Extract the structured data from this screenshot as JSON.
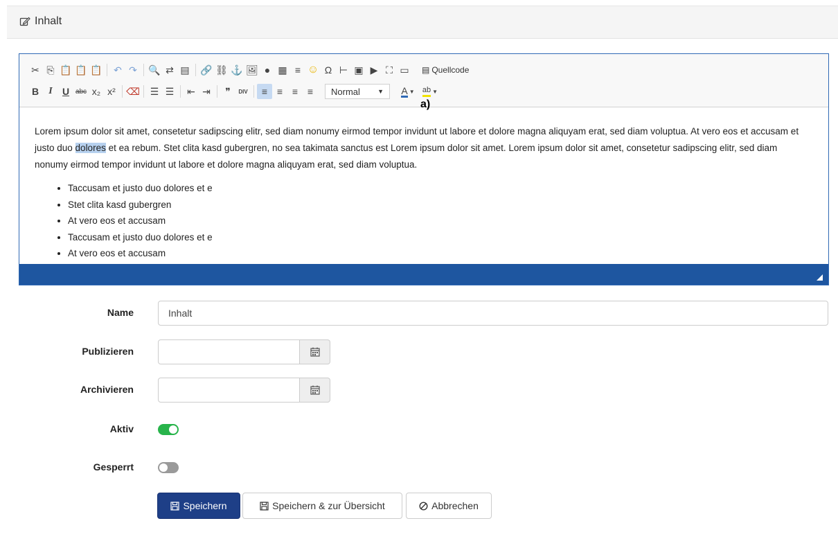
{
  "panel": {
    "title": "Inhalt",
    "icon": "edit-icon"
  },
  "editor": {
    "toolbar_row1": [
      {
        "name": "cut-icon",
        "glyph": "✂"
      },
      {
        "name": "copy-icon",
        "glyph": "⎘"
      },
      {
        "name": "paste-icon",
        "glyph": "📋"
      },
      {
        "name": "paste-text-icon",
        "glyph": "📋"
      },
      {
        "name": "paste-word-icon",
        "glyph": "📋"
      },
      {
        "name": "undo-icon",
        "glyph": "↶"
      },
      {
        "name": "redo-icon",
        "glyph": "↷"
      },
      {
        "name": "find-icon",
        "glyph": "🔍"
      },
      {
        "name": "replace-icon",
        "glyph": "⇄"
      },
      {
        "name": "select-all-icon",
        "glyph": "▤"
      },
      {
        "name": "link-icon",
        "glyph": "🔗"
      },
      {
        "name": "unlink-icon",
        "glyph": "⛓"
      },
      {
        "name": "anchor-icon",
        "glyph": "⚓"
      },
      {
        "name": "image-icon",
        "glyph": "🖼"
      },
      {
        "name": "flash-icon",
        "glyph": "●"
      },
      {
        "name": "table-icon",
        "glyph": "▦"
      },
      {
        "name": "horizontal-rule-icon",
        "glyph": "≡"
      },
      {
        "name": "smiley-icon",
        "glyph": "☺"
      },
      {
        "name": "special-char-icon",
        "glyph": "Ω"
      },
      {
        "name": "page-break-icon",
        "glyph": "⊢"
      },
      {
        "name": "template-icon",
        "glyph": "▣"
      },
      {
        "name": "youtube-icon",
        "glyph": "▶"
      },
      {
        "name": "maximize-icon",
        "glyph": "⛶"
      },
      {
        "name": "show-blocks-icon",
        "glyph": "▭"
      }
    ],
    "source_label": "Quellcode",
    "toolbar_row2": [
      {
        "name": "bold-icon",
        "glyph": "B"
      },
      {
        "name": "italic-icon",
        "glyph": "I"
      },
      {
        "name": "underline-icon",
        "glyph": "U"
      },
      {
        "name": "strikethrough-icon",
        "glyph": "abc"
      },
      {
        "name": "subscript-icon",
        "glyph": "x₂"
      },
      {
        "name": "superscript-icon",
        "glyph": "x²"
      },
      {
        "name": "remove-format-icon",
        "glyph": "⌫"
      },
      {
        "name": "numbered-list-icon",
        "glyph": "☰"
      },
      {
        "name": "bulleted-list-icon",
        "glyph": "☰"
      },
      {
        "name": "outdent-icon",
        "glyph": "⇤"
      },
      {
        "name": "indent-icon",
        "glyph": "⇥"
      },
      {
        "name": "blockquote-icon",
        "glyph": "❞"
      },
      {
        "name": "div-container-icon",
        "glyph": "DIV"
      },
      {
        "name": "align-left-icon",
        "glyph": "≡"
      },
      {
        "name": "align-center-icon",
        "glyph": "≡"
      },
      {
        "name": "align-right-icon",
        "glyph": "≡"
      },
      {
        "name": "align-justify-icon",
        "glyph": "≡"
      }
    ],
    "format_value": "Normal",
    "text_color_glyph": "A",
    "bg_color_glyph": "ab",
    "annotation": "a)",
    "paragraph": {
      "before": "Lorem ipsum dolor sit amet, consetetur sadipscing elitr, sed diam nonumy eirmod tempor invidunt ut labore et dolore magna aliquyam erat, sed diam voluptua. At vero eos et accusam et justo duo ",
      "selected": "dolores",
      "after": " et ea rebum. Stet clita kasd gubergren, no sea takimata sanctus est Lorem ipsum dolor sit amet. Lorem ipsum dolor sit amet, consetetur sadipscing elitr, sed diam nonumy eirmod tempor invidunt ut labore et dolore magna aliquyam erat, sed diam voluptua."
    },
    "list": [
      "Taccusam et justo duo dolores et e",
      "Stet clita kasd gubergren",
      "At vero eos et accusam",
      "Taccusam et justo duo dolores et e",
      "At vero eos et accusam"
    ]
  },
  "form": {
    "name_label": "Name",
    "name_value": "Inhalt",
    "publish_label": "Publizieren",
    "archive_label": "Archivieren",
    "active_label": "Aktiv",
    "active_on": true,
    "locked_label": "Gesperrt",
    "locked_on": false
  },
  "buttons": {
    "save": "Speichern",
    "save_overview": "Speichern & zur Übersicht",
    "cancel": "Abbrechen"
  },
  "colors": {
    "accent": "#1e56a0",
    "primary_button": "#1e3f87",
    "toggle_on": "#28b44b",
    "toggle_off": "#9a9a9a",
    "selection": "#b7d1ef"
  }
}
